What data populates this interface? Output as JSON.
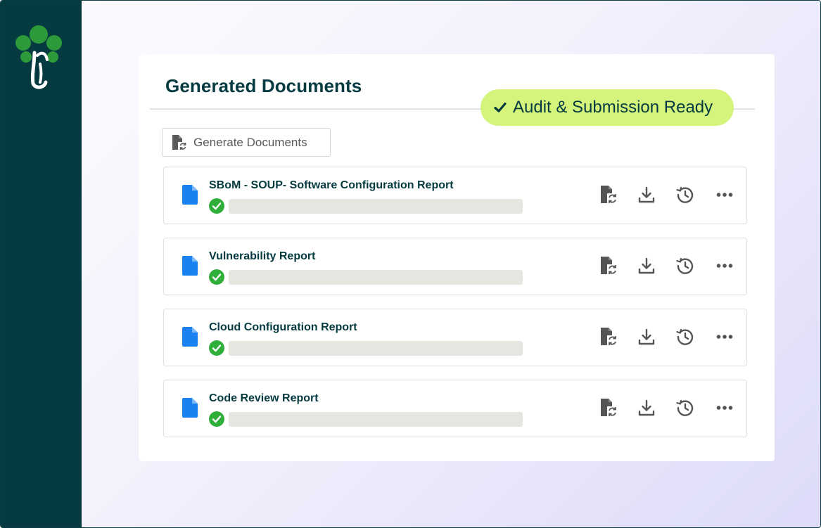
{
  "colors": {
    "sidebar": "#053b40",
    "title": "#053b40",
    "badge_bg": "#d4f47c",
    "file_icon": "#1a82f0",
    "check_green": "#2fae3a",
    "logo_green": "#2c9a3a"
  },
  "page": {
    "title": "Generated Documents"
  },
  "badge": {
    "icon": "check-icon",
    "label": "Audit & Submission Ready"
  },
  "generate_button": {
    "icon": "file-refresh-icon",
    "label": "Generate Documents"
  },
  "documents": [
    {
      "name": "SBoM - SOUP- Software Configuration Report",
      "status_icon": "check-circle-icon"
    },
    {
      "name": "Vulnerability Report",
      "status_icon": "check-circle-icon"
    },
    {
      "name": "Cloud Configuration Report",
      "status_icon": "check-circle-icon"
    },
    {
      "name": "Code Review Report",
      "status_icon": "check-circle-icon"
    }
  ],
  "row_actions": [
    "regenerate-icon",
    "download-icon",
    "history-icon",
    "more-icon"
  ]
}
